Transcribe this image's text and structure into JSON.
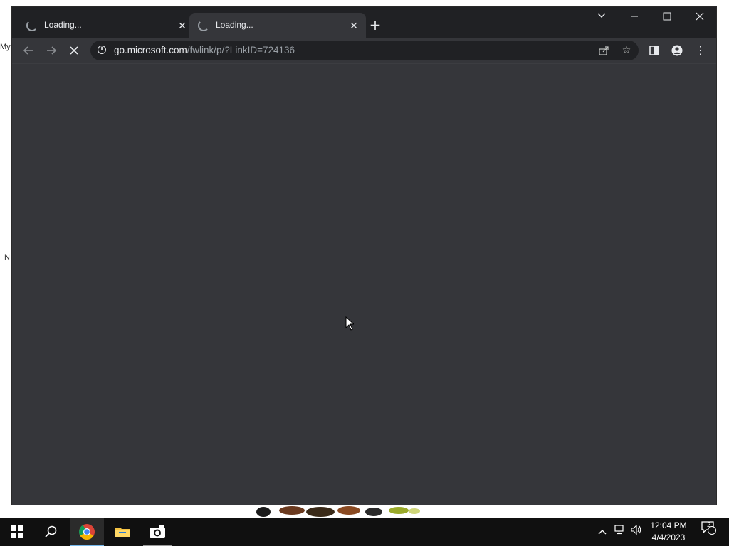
{
  "desktop": {
    "fragments": [
      "My",
      "N"
    ]
  },
  "browser": {
    "tabs": [
      {
        "title": "Loading...",
        "active": false
      },
      {
        "title": "Loading...",
        "active": true
      }
    ],
    "window_controls": {
      "tab_search": "tab-search-icon",
      "minimize": "minimize-icon",
      "maximize": "maximize-icon",
      "close": "close-icon"
    },
    "toolbar": {
      "back": "back-arrow-icon",
      "forward": "forward-arrow-icon",
      "stop": "stop-loading-icon"
    },
    "omnibox": {
      "host": "go.microsoft.com",
      "path": "/fwlink/p/?LinkID=724136"
    }
  },
  "taskbar": {
    "apps": [
      {
        "name": "Google Chrome",
        "icon": "chrome-icon",
        "active": true
      },
      {
        "name": "File Explorer",
        "icon": "folder-icon",
        "active": false
      },
      {
        "name": "Camera",
        "icon": "camera-icon",
        "active": false
      }
    ],
    "clock": {
      "time": "12:04 PM",
      "date": "4/4/2023"
    },
    "notifications_count": "2"
  },
  "colors": {
    "tabstrip": "#202124",
    "toolbar": "#35363a",
    "content": "#35363a",
    "taskbar": "#101010",
    "taskbar_accent": "#76b9ed"
  }
}
